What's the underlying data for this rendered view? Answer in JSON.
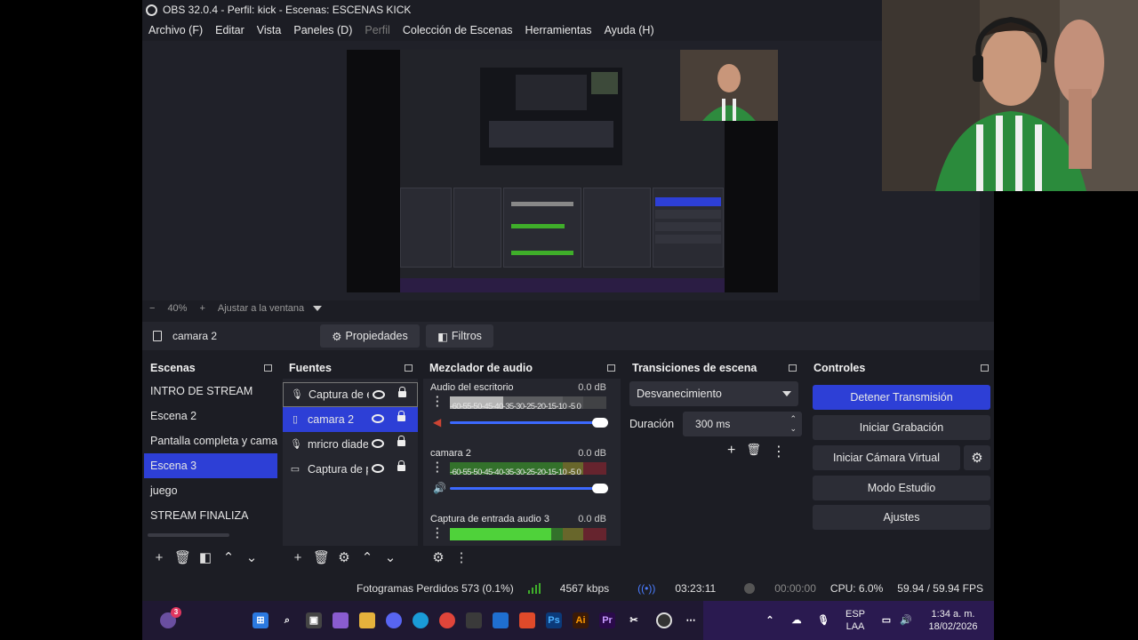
{
  "window": {
    "title": "OBS 32.0.4 - Perfil: kick - Escenas: ESCENAS KICK"
  },
  "menu": [
    "Archivo (F)",
    "Editar",
    "Vista",
    "Paneles (D)",
    "Perfil",
    "Colección de Escenas",
    "Herramientas",
    "Ayuda (H)"
  ],
  "preview": {
    "zoom": "40%",
    "fit_label": "Ajustar a la ventana"
  },
  "source_toolbar": {
    "selected_source": "camara 2",
    "properties_label": "Propiedades",
    "filters_label": "Filtros"
  },
  "scenes": {
    "title": "Escenas",
    "items": [
      "INTRO DE STREAM",
      "Escena 2",
      "Pantalla completa y cama",
      "Escena 3",
      "juego",
      "STREAM FINALIZA"
    ],
    "selected_index": 3
  },
  "sources": {
    "title": "Fuentes",
    "items": [
      {
        "label": "Captura de entrada",
        "icon": "microphone-icon"
      },
      {
        "label": "camara 2",
        "icon": "document-icon"
      },
      {
        "label": "mricro diadema",
        "icon": "microphone-icon"
      },
      {
        "label": "Captura de pantalla",
        "icon": "monitor-icon"
      }
    ],
    "selected_index": 1
  },
  "mixer": {
    "title": "Mezclador de audio",
    "ticks": "-60-55-50-45-40-35-30-25-20-15-10 -5  0",
    "channels": [
      {
        "name": "Audio del escritorio",
        "db": "0.0 dB",
        "muted": true,
        "level": 0.34
      },
      {
        "name": "camara 2",
        "db": "0.0 dB",
        "muted": false,
        "level": 0.0
      },
      {
        "name": "Captura de entrada audio 3",
        "db": "0.0 dB",
        "muted": false,
        "level": 0.65
      }
    ]
  },
  "transitions": {
    "title": "Transiciones de escena",
    "selected": "Desvanecimiento",
    "duration_label": "Duración",
    "duration_value": "300 ms"
  },
  "controls": {
    "title": "Controles",
    "stop_stream": "Detener Transmisión",
    "start_recording": "Iniciar Grabación",
    "start_virtual_cam": "Iniciar Cámara Virtual",
    "studio_mode": "Modo Estudio",
    "settings": "Ajustes"
  },
  "status": {
    "dropped_frames": "Fotogramas Perdidos 573 (0.1%)",
    "bitrate": "4567 kbps",
    "stream_time": "03:23:11",
    "record_time": "00:00:00",
    "cpu": "CPU: 6.0%",
    "fps": "59.94 / 59.94 FPS"
  },
  "taskbar": {
    "badge_count": "3",
    "lang_top": "ESP",
    "lang_bottom": "LAA",
    "time": "1:34 a. m.",
    "date": "18/02/2026"
  },
  "colors": {
    "accent": "#2d3fd6",
    "panel_bg": "#1c1d24",
    "meter_green": "#3fae2a",
    "meter_yellow": "#a19a2a",
    "meter_red": "#9c2230"
  }
}
